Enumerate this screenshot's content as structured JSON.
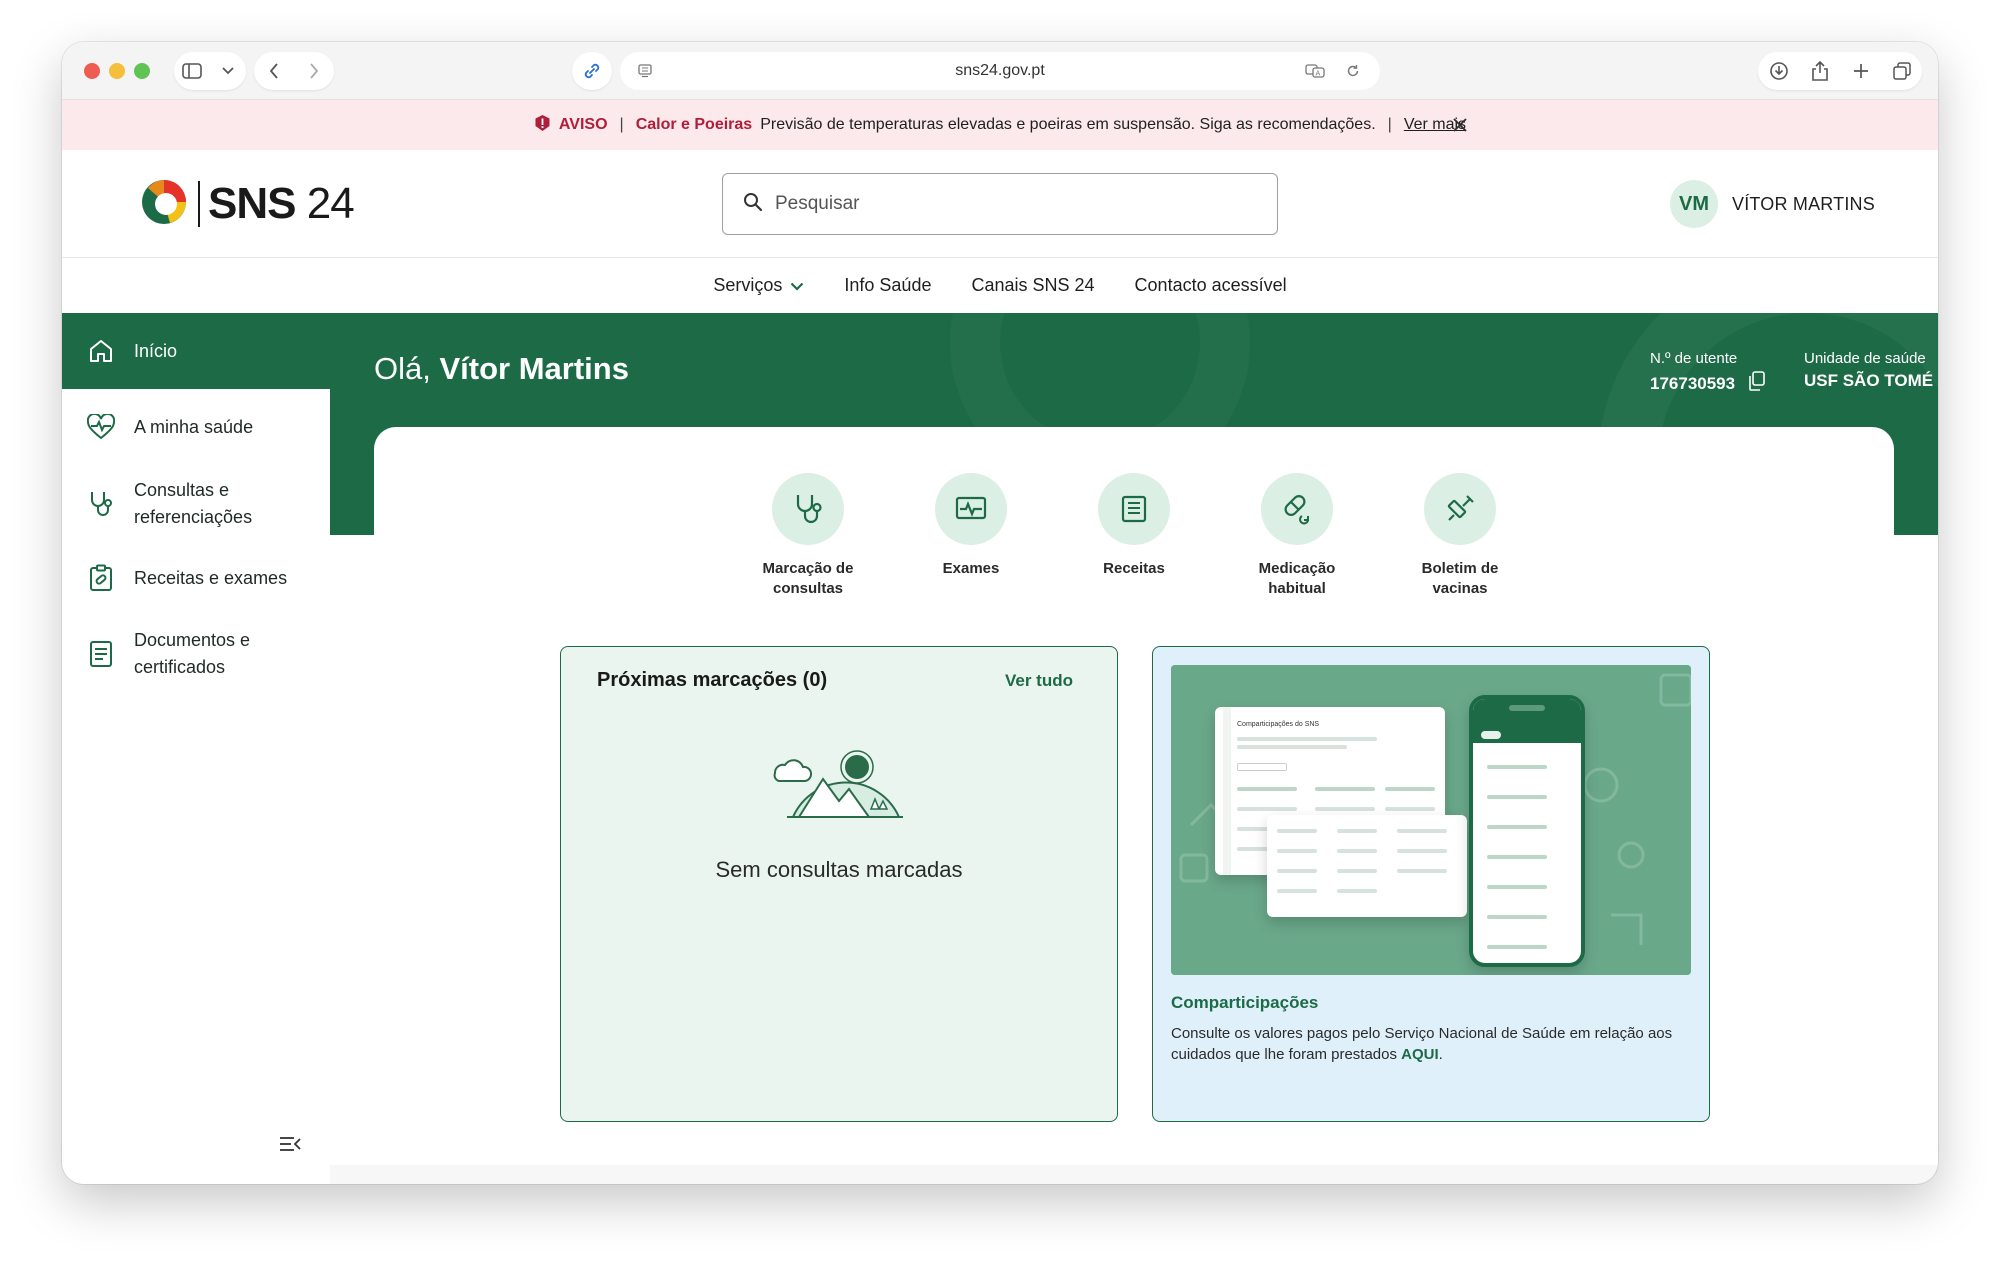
{
  "browser": {
    "url": "sns24.gov.pt"
  },
  "alert": {
    "label": "AVISO",
    "category": "Calor e Poeiras",
    "message": "Previsão de temperaturas elevadas e poeiras em suspensão. Siga as recomendações.",
    "link": "Ver mais"
  },
  "header": {
    "logo_bold": "SNS",
    "logo_light": "24",
    "search_placeholder": "Pesquisar",
    "user_initials": "VM",
    "user_name": "VÍTOR MARTINS"
  },
  "nav": {
    "items": [
      "Serviços",
      "Info Saúde",
      "Canais SNS 24",
      "Contacto acessível"
    ]
  },
  "sidebar": {
    "items": [
      {
        "label": "Início"
      },
      {
        "label": "A minha saúde"
      },
      {
        "label": "Consultas e referenciações"
      },
      {
        "label": "Receitas e exames"
      },
      {
        "label": "Documentos e certificados"
      }
    ]
  },
  "hero": {
    "greeting_prefix": "Olá,",
    "greeting_name": "Vítor Martins",
    "utente_label": "N.º de utente",
    "utente_value": "176730593",
    "unidade_label": "Unidade de saúde",
    "unidade_value": "USF SÃO TOMÉ"
  },
  "quick_actions": [
    {
      "label": "Marcação de consultas",
      "icon": "stethoscope-icon"
    },
    {
      "label": "Exames",
      "icon": "monitor-ecg-icon"
    },
    {
      "label": "Receitas",
      "icon": "prescription-icon"
    },
    {
      "label": "Medicação habitual",
      "icon": "pill-icon"
    },
    {
      "label": "Boletim de vacinas",
      "icon": "syringe-icon"
    }
  ],
  "appointments": {
    "title": "Próximas marcações (0)",
    "link": "Ver tudo",
    "empty_text": "Sem consultas marcadas"
  },
  "promo": {
    "title": "Comparticipações",
    "text": "Consulte os valores pagos pelo Serviço Nacional de Saúde em relação aos cuidados que lhe foram prestados",
    "link": "AQUI",
    "mock_title": "Comparticipações do SNS"
  },
  "colors": {
    "brand_green": "#1d6b46",
    "light_green": "#dcefe4",
    "alert_bg": "#fbe9eb",
    "alert_red": "#b01e3a"
  }
}
